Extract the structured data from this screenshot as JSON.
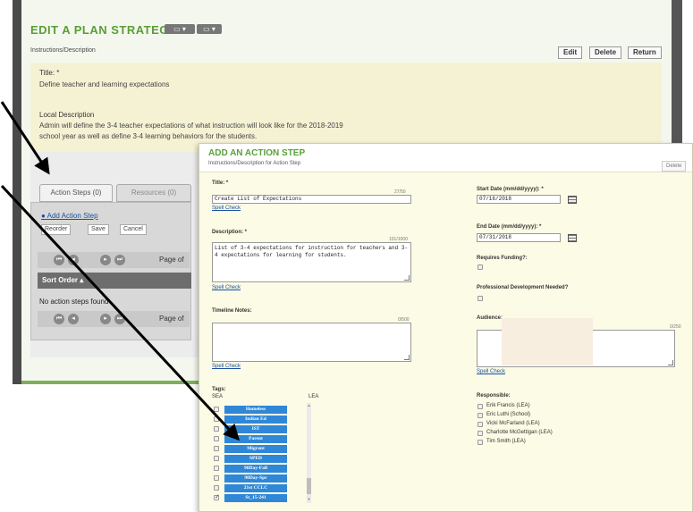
{
  "background": {
    "title": "EDIT A PLAN STRATEGY",
    "subtitle": "Instructions/Description",
    "buttons": [
      "Edit",
      "Delete",
      "Return"
    ],
    "title_label": "Title: *",
    "title_value": "Define teacher and learning expectations",
    "desc_label": "Local Description",
    "desc_line1": "Admin will define the 3-4 teacher expectations of what instruction will look like for the 2018-2019",
    "desc_line2": "school year as well as define 3-4 learning behaviors for the students.",
    "tabs": [
      "Action Steps (0)",
      "Resources (0)"
    ],
    "add_link": "Add Action Step",
    "small_buttons": [
      "Reorder",
      "Save",
      "Cancel"
    ],
    "page_label_1": "Page of",
    "sort_header": "Sort Order",
    "empty_text": "No action steps found",
    "page_label_2": "Page of"
  },
  "dialog": {
    "title": "ADD AN ACTION STEP",
    "subtitle": "Instructions/Description for Action Step",
    "delete_label": "Delete",
    "title_label": "Title: *",
    "title_counter": "27/50",
    "title_value": "Create List of Expectations",
    "spell_check": "Spell Check",
    "description_label": "Description: *",
    "description_counter": "101/1000",
    "description_value": "List of 3-4 expectations for instruction for teachers and 3-4 expectations for learning for students.",
    "timeline_label": "Timeline Notes:",
    "timeline_counter": "0/500",
    "start_label": "Start Date (mm/dd/yyyy): *",
    "start_value": "07/16/2018",
    "end_label": "End Date (mm/dd/yyyy): *",
    "end_value": "07/31/2018",
    "funding_label": "Requires Funding?:",
    "pd_label": "Professional Development Needed?",
    "audience_label": "Audience:",
    "audience_counter": "0/250",
    "tags_label": "Tags:",
    "sea_label": "SEA",
    "lea_label": "LEA",
    "tags": [
      {
        "label": "Homeless",
        "checked": false
      },
      {
        "label": "Indian Ed",
        "checked": false
      },
      {
        "label": "IST",
        "checked": false
      },
      {
        "label": "Parent",
        "checked": false
      },
      {
        "label": "Migrant",
        "checked": false
      },
      {
        "label": "SPED",
        "checked": false
      },
      {
        "label": "90Day-Fall",
        "checked": false
      },
      {
        "label": "90Day-Spr",
        "checked": false
      },
      {
        "label": "21st CCLC",
        "checked": false
      },
      {
        "label": "St_15-241",
        "checked": true
      }
    ],
    "responsible_label": "Responsible:",
    "responsible": [
      "Erik Francis (LEA)",
      "Eric Luthi (School)",
      "Vicki McFarland (LEA)",
      "Charlotte McGettigan (LEA)",
      "Tim Smith (LEA)"
    ]
  },
  "colors": {
    "accent_green": "#5aa03a",
    "tag_blue": "#2f87d8",
    "dialog_bg": "#fcfbe5",
    "arrow": "#000000"
  }
}
